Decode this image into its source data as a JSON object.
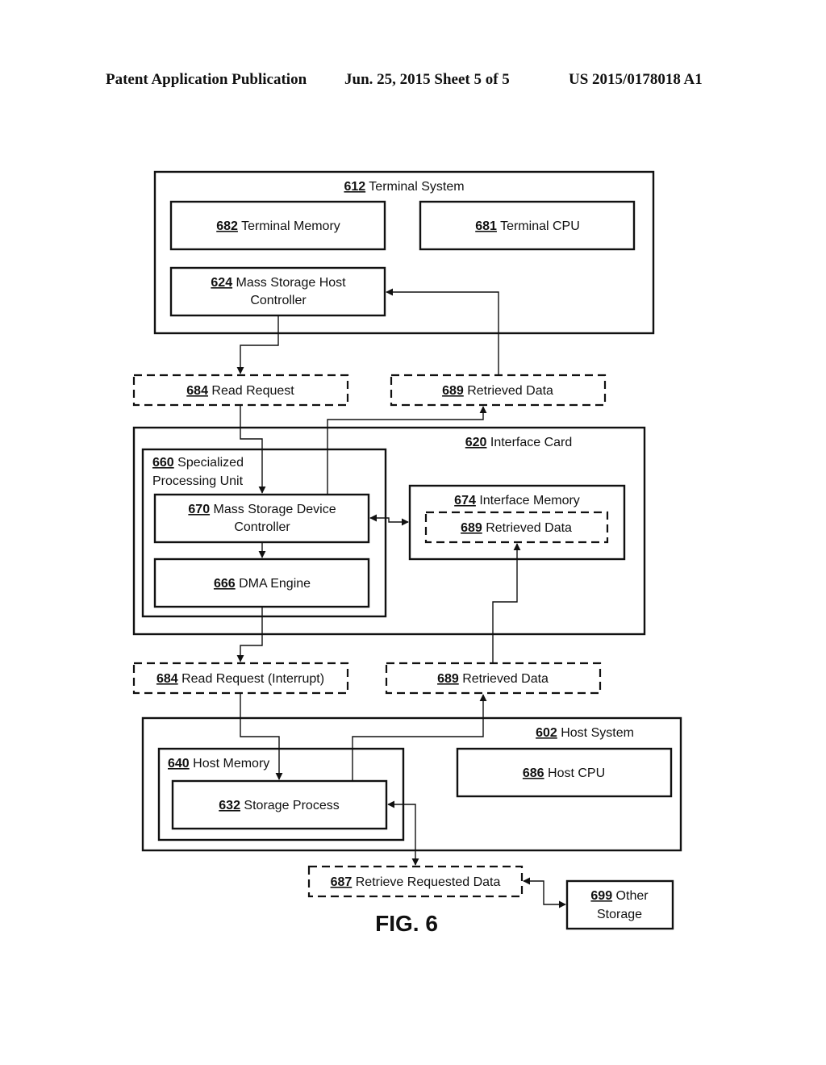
{
  "header": {
    "left": "Patent Application Publication",
    "middle": "Jun. 25, 2015  Sheet 5 of 5",
    "right": "US 2015/0178018 A1"
  },
  "figure_label": "FIG. 6",
  "boxes": {
    "b612": {
      "num": "612",
      "line1": " Terminal System",
      "line2": ""
    },
    "b682": {
      "num": "682",
      "line1": " Terminal Memory",
      "line2": ""
    },
    "b681": {
      "num": "681",
      "line1": " Terminal CPU",
      "line2": ""
    },
    "b624": {
      "num": "624",
      "line1": " Mass Storage Host",
      "line2": "Controller"
    },
    "b684a": {
      "num": "684",
      "line1": " Read Request",
      "line2": ""
    },
    "b689a": {
      "num": "689",
      "line1": " Retrieved Data",
      "line2": ""
    },
    "b620": {
      "num": "620",
      "line1": " Interface Card",
      "line2": ""
    },
    "b660": {
      "num": "660",
      "line1": " Specialized",
      "line2": "Processing Unit"
    },
    "b670": {
      "num": "670",
      "line1": " Mass Storage Device",
      "line2": "Controller"
    },
    "b666": {
      "num": "666",
      "line1": " DMA Engine",
      "line2": ""
    },
    "b674": {
      "num": "674",
      "line1": " Interface Memory",
      "line2": ""
    },
    "b689b": {
      "num": "689",
      "line1": " Retrieved Data",
      "line2": ""
    },
    "b684b": {
      "num": "684",
      "line1": " Read Request (Interrupt)",
      "line2": ""
    },
    "b689c": {
      "num": "689",
      "line1": " Retrieved Data",
      "line2": ""
    },
    "b602": {
      "num": "602",
      "line1": " Host System",
      "line2": ""
    },
    "b640": {
      "num": "640",
      "line1": " Host Memory",
      "line2": ""
    },
    "b632": {
      "num": "632",
      "line1": " Storage Process",
      "line2": ""
    },
    "b686": {
      "num": "686",
      "line1": " Host CPU",
      "line2": ""
    },
    "b687": {
      "num": "687",
      "line1": " Retrieve Requested Data",
      "line2": ""
    },
    "b699": {
      "num": "699",
      "line1": " Other",
      "line2": "Storage"
    }
  }
}
